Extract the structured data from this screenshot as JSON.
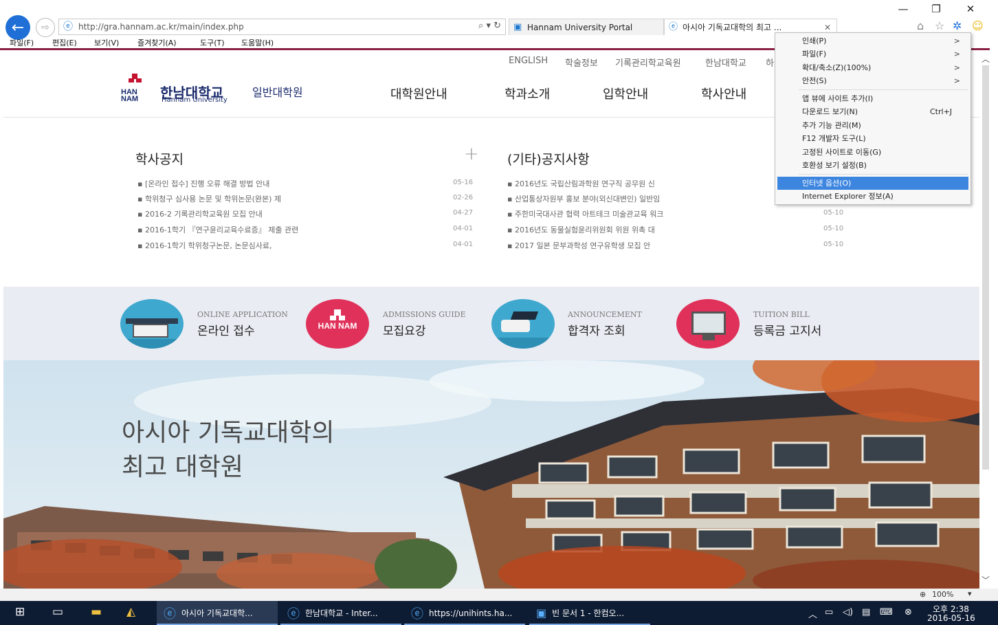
{
  "browser": {
    "url": "http://gra.hannam.ac.kr/main/index.php",
    "address_controls": "⌕ ▾ ↻",
    "tabs": [
      {
        "label": "Hannam University Portal"
      },
      {
        "label": "아시아 기독교대학의 최고 ..."
      }
    ],
    "menubar": [
      "파일(F)",
      "편집(E)",
      "보기(V)",
      "즐겨찾기(A)",
      "도구(T)",
      "도움말(H)"
    ],
    "window_controls": {
      "minimize": "—",
      "restore": "❐",
      "close": "✕"
    },
    "zoom_status": "100%"
  },
  "site": {
    "utility_links": [
      "ENGLISH",
      "학술정보",
      "기록관리학교육원",
      "한남대학교",
      "하"
    ],
    "logo_mark": "HAN NAM",
    "logo_text": "한남대학교",
    "logo_sub": "Hannam University",
    "logo_suffix": "일반대학원",
    "gnb": [
      "대학원안내",
      "학과소개",
      "입학안내",
      "학사안내"
    ],
    "board_left": {
      "title": "학사공지",
      "more": "+",
      "items": [
        {
          "text": "[온라인 접수] 진행 오류 해결 방법 안내",
          "date": "05-16"
        },
        {
          "text": "학위청구 심사용 논문 및 학위논문(완본) 제",
          "date": "02-26"
        },
        {
          "text": "2016-2 기록관리학교육원 모집 안내",
          "date": "04-27"
        },
        {
          "text": "2016-1학기 『연구윤리교육수료증』 제출 관련",
          "date": "04-01"
        },
        {
          "text": "2016-1학기 학위청구논문, 논문심사료,",
          "date": "04-01"
        }
      ]
    },
    "board_right": {
      "title": "(기타)공지사항",
      "items": [
        {
          "text": "2016년도 국립산림과학원 연구직 공무원 신",
          "date": ""
        },
        {
          "text": "산업통상자원부 홍보 분야(외신대변인) 일반임",
          "date": ""
        },
        {
          "text": "주한미국대사관 협력 아트테크 미술관교육 워크",
          "date": "05-10"
        },
        {
          "text": "2016년도 동물실험윤리위원회 위원 위촉 대",
          "date": "05-10"
        },
        {
          "text": "2017 일본 문부과학성 연구유학생 모집 안",
          "date": "05-10"
        }
      ]
    },
    "quick": [
      {
        "en": "ONLINE APPLICATION",
        "ko": "온라인 접수",
        "color": "#3fa8cf"
      },
      {
        "en": "ADMISSIONS GUIDE",
        "ko": "모집요강",
        "color": "#e0315a"
      },
      {
        "en": "ANNOUNCEMENT",
        "ko": "합격자 조회",
        "color": "#3fa8cf"
      },
      {
        "en": "TUITION BILL",
        "ko": "등록금 고지서",
        "color": "#e0315a"
      }
    ],
    "hero_line1": "아시아 기독교대학의",
    "hero_line2": "최고 대학원"
  },
  "ie_menu": [
    {
      "label": "인쇄(P)",
      "arrow": ">"
    },
    {
      "label": "파일(F)",
      "arrow": ">"
    },
    {
      "label": "확대/축소(Z)(100%)",
      "arrow": ">"
    },
    {
      "label": "안전(S)",
      "arrow": ">"
    },
    {
      "label": "앱 뷰에 사이트 추가(I)"
    },
    {
      "label": "다운로드 보기(N)",
      "accel": "Ctrl+J"
    },
    {
      "label": "추가 기능 관리(M)"
    },
    {
      "label": "F12 개발자 도구(L)"
    },
    {
      "label": "고정된 사이트로 이동(G)"
    },
    {
      "label": "호환성 보기 설정(B)"
    },
    {
      "label": "인터넷 옵션(O)"
    },
    {
      "label": "Internet Explorer 정보(A)"
    }
  ],
  "taskbar": {
    "apps": [
      {
        "label": "아시아 기독교대학..."
      },
      {
        "label": "한남대학교 - Inter..."
      },
      {
        "label": "https://unihints.ha..."
      },
      {
        "label": "빈 문서 1 - 한컴오..."
      }
    ],
    "time": "오후 2:38",
    "date": "2016-05-16"
  },
  "colors": {
    "accent": "#8a2044",
    "ie_blue": "#1f6fd6",
    "highlight": "#3d86e0"
  }
}
